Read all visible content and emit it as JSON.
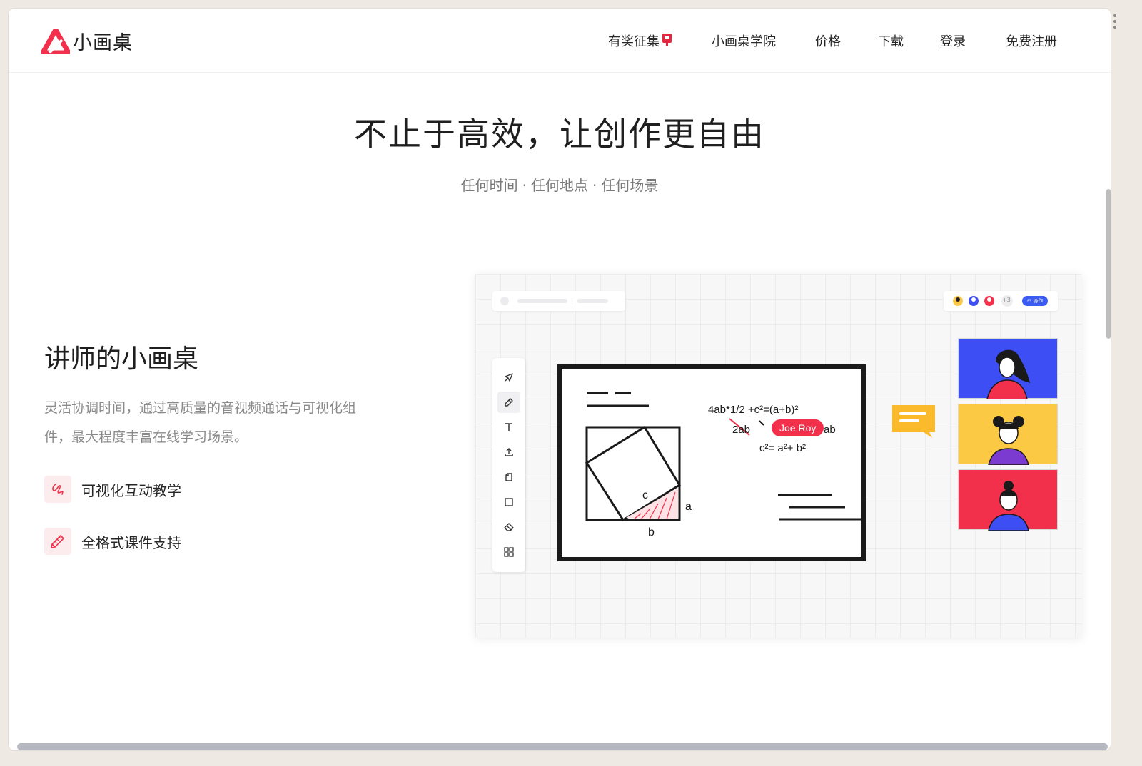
{
  "header": {
    "logo_text": "小画桌",
    "nav": [
      {
        "label": "有奖征集",
        "has_badge": true
      },
      {
        "label": "小画桌学院"
      },
      {
        "label": "价格"
      },
      {
        "label": "下载"
      },
      {
        "label": "登录"
      },
      {
        "label": "免费注册"
      }
    ]
  },
  "hero": {
    "title": "不止于高效，让创作更自由",
    "subtitle_parts": [
      "任何时间",
      "任何地点",
      "任何场景"
    ],
    "separator": "·"
  },
  "feature": {
    "title": "讲师的小画桌",
    "description": "灵活协调时间，通过高质量的音视频通话与可视化组件，最大程度丰富在线学习场景。",
    "items": [
      {
        "label": "可视化互动教学",
        "icon": "scribble-icon"
      },
      {
        "label": "全格式课件支持",
        "icon": "ruler-pencil-icon"
      }
    ]
  },
  "illustration": {
    "collab_count": "+3",
    "collab_button": "⚇ 协作",
    "equation_1": "4ab*1/2 +c²=(a+b)²",
    "equation_2_struck": "2ab",
    "equation_2_tail": "ab",
    "equation_3": "c²= a²+ b²",
    "label_c": "c",
    "label_a": "a",
    "label_b": "b",
    "cursor_name": "Joe Roy",
    "tools": [
      "pointer-icon",
      "pen-icon",
      "text-icon",
      "upload-icon",
      "note-icon",
      "shape-icon",
      "eraser-icon",
      "grid-icon"
    ]
  },
  "colors": {
    "brand": "#f2304b",
    "accent_blue": "#3a5cf5",
    "video_blue": "#3d4ef5",
    "video_yellow": "#fbc943",
    "video_red": "#f2304b",
    "comment_yellow": "#fbb92c"
  }
}
